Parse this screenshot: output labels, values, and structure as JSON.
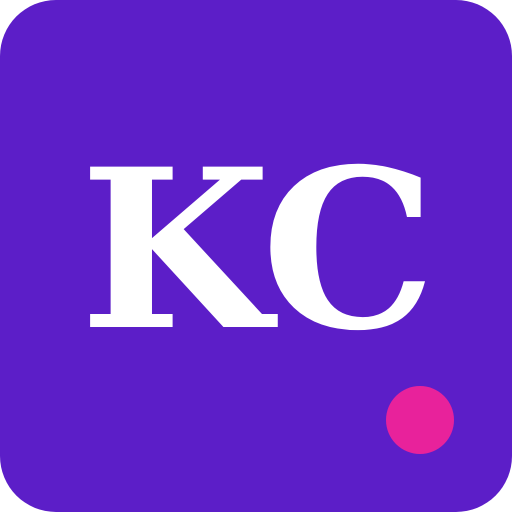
{
  "icon": {
    "monogram": "KC",
    "background_color": "#5c1ec8",
    "text_color": "#ffffff",
    "dot_color": "#e8229b"
  }
}
